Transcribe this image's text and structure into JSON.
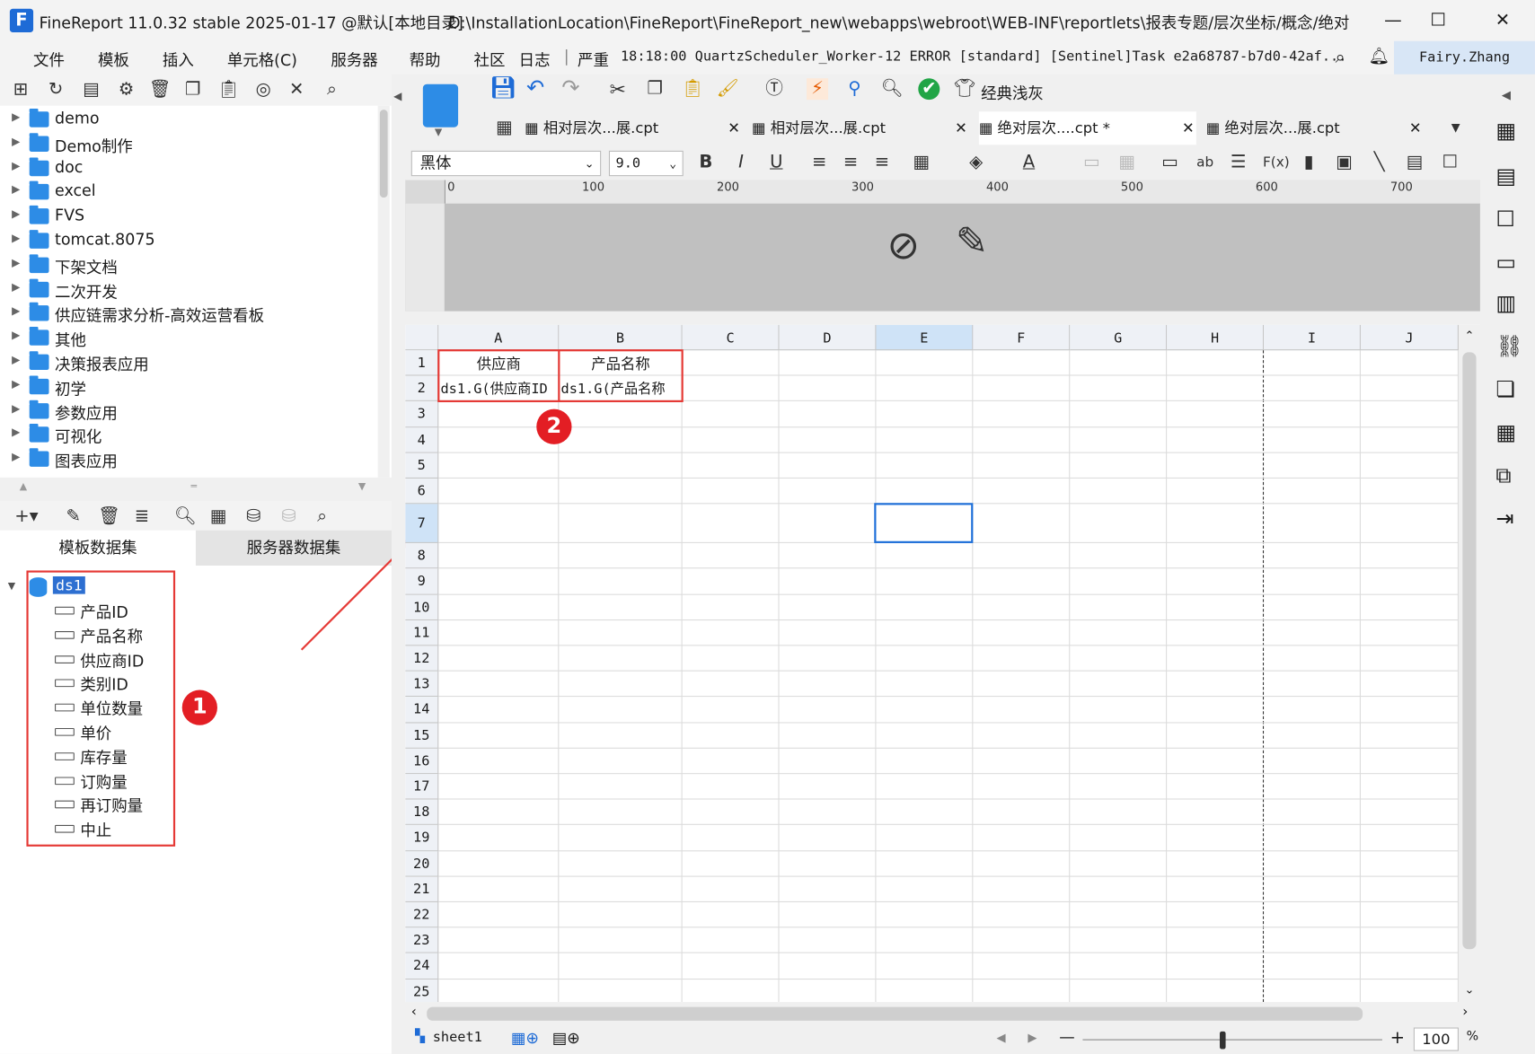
{
  "window": {
    "title": "FineReport 11.0.32 stable 2025-01-17 @默认[本地目录]",
    "path": "D:\\InstallationLocation\\FineReport\\FineReport_new\\webapps\\webroot\\WEB-INF\\reportlets\\报表专题/层次坐标/概念/绝对层..."
  },
  "menubar": {
    "items": [
      "文件",
      "模板",
      "插入",
      "单元格(C)",
      "服务器",
      "帮助",
      "社区",
      "日志"
    ],
    "log_level": "严重",
    "log_text": "18:18:00 QuartzScheduler_Worker-12 ERROR [standard] [Sentinel]Task e2a68787-b7d0-42af...",
    "user": "Fairy.Zhang"
  },
  "tree": {
    "items": [
      "demo",
      "Demo制作",
      "doc",
      "excel",
      "FVS",
      "tomcat.8075",
      "下架文档",
      "二次开发",
      "供应链需求分析-高效运营看板",
      "其他",
      "决策报表应用",
      "初学",
      "参数应用",
      "可视化",
      "图表应用"
    ]
  },
  "datasets": {
    "tabs": [
      "模板数据集",
      "服务器数据集"
    ],
    "dataset_name": "ds1",
    "fields": [
      "产品ID",
      "产品名称",
      "供应商ID",
      "类别ID",
      "单位数量",
      "单价",
      "库存量",
      "订购量",
      "再订购量",
      "中止"
    ]
  },
  "doc_tabs": [
    "相对层次...展.cpt",
    "相对层次...展.cpt",
    "绝对层次....cpt *",
    "绝对层次...展.cpt"
  ],
  "style_button": "经典浅灰",
  "format": {
    "font": "黑体",
    "size": "9.0"
  },
  "ruler_ticks": [
    "0",
    "100",
    "200",
    "300",
    "400",
    "500",
    "600",
    "700"
  ],
  "grid": {
    "columns": [
      "A",
      "B",
      "C",
      "D",
      "E",
      "F",
      "G",
      "H",
      "I",
      "J"
    ],
    "rows": [
      "1",
      "2",
      "3",
      "4",
      "5",
      "6",
      "7",
      "8",
      "9",
      "10",
      "11",
      "12",
      "13",
      "14",
      "15",
      "16",
      "17",
      "18",
      "19",
      "20",
      "21",
      "22",
      "23",
      "24",
      "25"
    ],
    "cells": {
      "A1": "供应商",
      "B1": "产品名称",
      "A2": "ds1.G(供应商ID",
      "B2": "ds1.G(产品名称"
    }
  },
  "annotations": {
    "badge1": "1",
    "badge2": "2"
  },
  "status": {
    "sheet": "sheet1",
    "zoom": "100",
    "zoom_unit": "%"
  },
  "colors": {
    "accent": "#2d8ce6",
    "highlight": "#e53935",
    "selection": "#1e6fd9"
  }
}
